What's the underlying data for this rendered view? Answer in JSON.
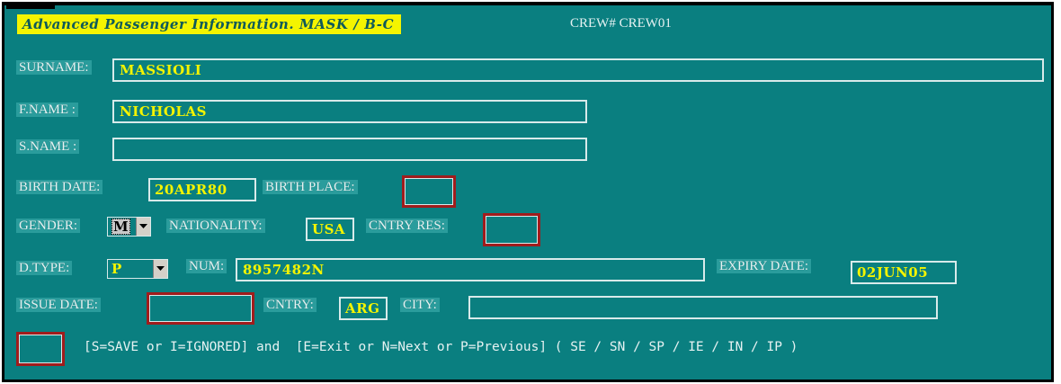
{
  "header": {
    "title": "Advanced Passenger Information. MASK / B-C",
    "crew_label": "CREW# CREW01"
  },
  "form": {
    "surname": {
      "label": "SURNAME:",
      "value": "MASSIOLI"
    },
    "first_name": {
      "label": "F.NAME :",
      "value": "NICHOLAS"
    },
    "second_name": {
      "label": "S.NAME :",
      "value": ""
    },
    "birth_date": {
      "label": "BIRTH DATE:",
      "value": "20APR80"
    },
    "birth_place": {
      "label": "BIRTH PLACE:",
      "value": ""
    },
    "gender": {
      "label": "GENDER:",
      "value": "M"
    },
    "nationality": {
      "label": "NATIONALITY:",
      "value": "USA"
    },
    "country_res": {
      "label": "CNTRY RES:",
      "value": ""
    },
    "doc_type": {
      "label": "D.TYPE:",
      "value": "P"
    },
    "number": {
      "label": "NUM:",
      "value": "8957482N"
    },
    "expiry_date": {
      "label": "EXPIRY DATE:",
      "value": "02JUN05"
    },
    "issue_date": {
      "label": "ISSUE DATE:",
      "value": ""
    },
    "country": {
      "label": "CNTRY:",
      "value": "ARG"
    },
    "city": {
      "label": "CITY:",
      "value": ""
    }
  },
  "command": {
    "value": "",
    "instructions": "[S=SAVE or I=IGNORED] and  [E=Exit or N=Next or P=Previous] ( SE / SN / SP / IE / IN / IP )"
  },
  "colors": {
    "background": "#0a7f80",
    "title_bg": "#f4f400",
    "value_text": "#f4f400",
    "required_border": "#a01c1c"
  }
}
